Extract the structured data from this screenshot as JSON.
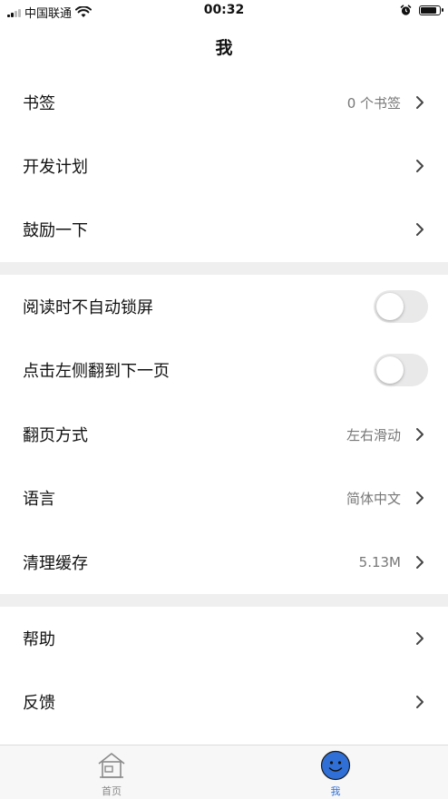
{
  "status_bar": {
    "carrier": "中国联通",
    "time": "00:32",
    "battery_level": 0.9
  },
  "nav": {
    "title": "我"
  },
  "section1": [
    {
      "label": "书签",
      "value": "0 个书签"
    },
    {
      "label": "开发计划",
      "value": ""
    },
    {
      "label": "鼓励一下",
      "value": ""
    }
  ],
  "section2": {
    "toggles": [
      {
        "label": "阅读时不自动锁屏",
        "on": false
      },
      {
        "label": "点击左侧翻到下一页",
        "on": false
      }
    ],
    "items": [
      {
        "label": "翻页方式",
        "value": "左右滑动"
      },
      {
        "label": "语言",
        "value": "简体中文"
      },
      {
        "label": "清理缓存",
        "value": "5.13M"
      }
    ]
  },
  "section3": [
    {
      "label": "帮助",
      "value": ""
    },
    {
      "label": "反馈",
      "value": ""
    }
  ],
  "tabbar": {
    "items": [
      {
        "label": "首页",
        "icon": "home-icon",
        "active": false
      },
      {
        "label": "我",
        "icon": "smiley-icon",
        "active": true
      }
    ]
  },
  "colors": {
    "accent": "#2f6fd6",
    "separator": "#efefef",
    "toggle_off": "#e9e9ea"
  }
}
